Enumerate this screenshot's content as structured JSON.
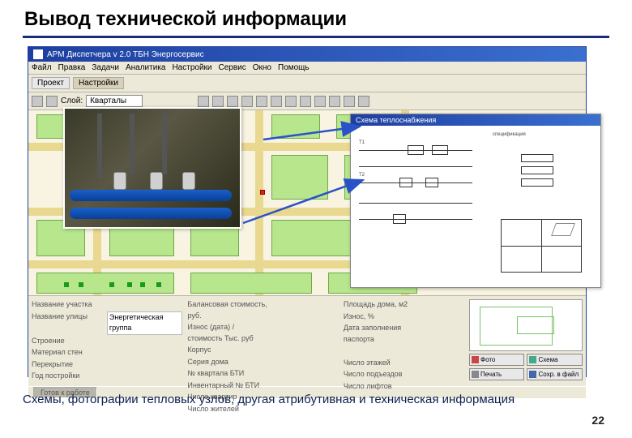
{
  "slide": {
    "title": "Вывод технической информации",
    "caption": "Схемы, фотографии тепловых узлов, другая атрибутивная и техническая информация",
    "page": "22"
  },
  "app": {
    "title": "АРМ Диспетчера v 2.0 ТБН Энергосервис",
    "menu": [
      "Файл",
      "Правка",
      "Задачи",
      "Аналитика",
      "Настройки",
      "Сервис",
      "Окно",
      "Помощь"
    ],
    "toolbar1": {
      "project_btn": "Проект",
      "settings_btn": "Настройки",
      "layer_label": "Слой:",
      "layer_value": "Кварталы"
    },
    "status": "Готов к работе"
  },
  "attrs": {
    "col1": [
      {
        "label": "Название участка",
        "val": ""
      },
      {
        "label": "Название улицы",
        "val": ""
      },
      {
        "label": "Строение",
        "val": ""
      },
      {
        "label": "Материал стен",
        "val": ""
      },
      {
        "label": "Перекрытие",
        "val": ""
      },
      {
        "label": "Год постройки",
        "val": ""
      }
    ],
    "col1b": "Энергетическая группа",
    "col2": [
      {
        "label": "Балансовая стоимость, руб.",
        "val": ""
      },
      {
        "label": "Износ (дата) / стоимость Тыс. руб",
        "val": ""
      },
      {
        "label": "Корпус",
        "val": ""
      },
      {
        "label": "Серия дома",
        "val": ""
      },
      {
        "label": "№ квартала БТИ",
        "val": ""
      },
      {
        "label": "Инвентарный № БТИ",
        "val": ""
      },
      {
        "label": "Число квартир",
        "val": ""
      },
      {
        "label": "Число жителей",
        "val": ""
      }
    ],
    "col3": [
      {
        "label": "Площадь дома, м2",
        "val": ""
      },
      {
        "label": "Износ, %",
        "val": ""
      },
      {
        "label": "Дата заполнения паспорта",
        "val": ""
      },
      {
        "label": "Число этажей",
        "val": ""
      },
      {
        "label": "Число подъездов",
        "val": ""
      },
      {
        "label": "Число лифтов",
        "val": ""
      }
    ],
    "buttons": {
      "photo": "Фото",
      "scheme": "Схема",
      "print": "Печать",
      "save": "Сохр. в файл"
    }
  },
  "diagram": {
    "title": "Схема теплоснабжения"
  }
}
